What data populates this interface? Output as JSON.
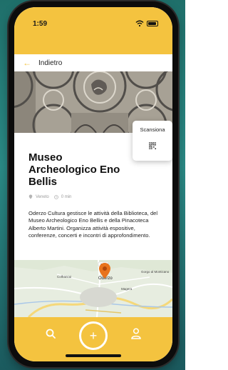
{
  "status_bar": {
    "time": "1:59",
    "wifi_icon": "wifi-icon",
    "battery_icon": "battery-icon"
  },
  "navigation": {
    "back_icon": "arrow-left-icon",
    "back_label": "Indietro"
  },
  "museum": {
    "title": "Museo Archeologico Eno Bellis",
    "location": "Veneto",
    "duration": "0 min",
    "location_icon": "location-pin-icon",
    "time_icon": "clock-icon",
    "description": "Oderzo Cultura gestisce le attività della Biblioteca, del Museo Archeologico Eno Bellis e della Pinacoteca Alberto Martini. Organizza attività espositive, conferenze, concerti e incontri di approfondimento."
  },
  "scan_popup": {
    "label": "Scansiona",
    "icon": "qr-code-icon"
  },
  "map": {
    "labels": [
      "SP15",
      "Colfrancui",
      "Oderzo",
      "Gorgo al Monticano",
      "Magera"
    ],
    "marker_icon": "map-pin-icon"
  },
  "tab_bar": {
    "search_icon": "search-icon",
    "add_label": "+",
    "profile_icon": "user-icon"
  },
  "colors": {
    "accent": "#f4c33f",
    "marker": "#e8731c",
    "text": "#111111"
  }
}
